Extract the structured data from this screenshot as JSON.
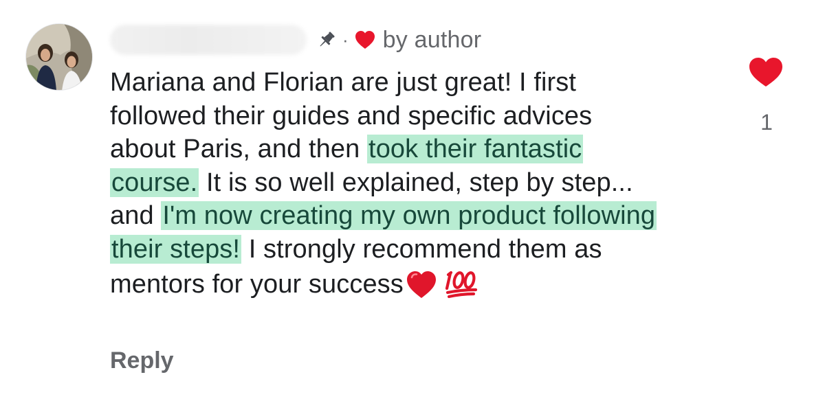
{
  "comment": {
    "meta": {
      "separator": "·",
      "author_label": "by author"
    },
    "body": {
      "p1": "Mariana and Florian are just great! I first followed their guides and specific advices about Paris, and then ",
      "h1": "took their fantastic course.",
      "p2": " It is so well explained, step by step... and ",
      "h2": "I'm now creating my own product following their steps!",
      "p3": " I strongly recommend them as mentors for your success"
    },
    "reply_label": "Reply",
    "likes": {
      "count": "1"
    },
    "colors": {
      "highlight": "#b8ecd2",
      "heart": "#e8162c",
      "muted_text": "#65676b",
      "body_text": "#1c1e21"
    },
    "icons": [
      "avatar",
      "pin-icon",
      "author-heart-icon",
      "red-heart-emoji",
      "hundred-points-emoji",
      "like-heart-icon"
    ]
  }
}
